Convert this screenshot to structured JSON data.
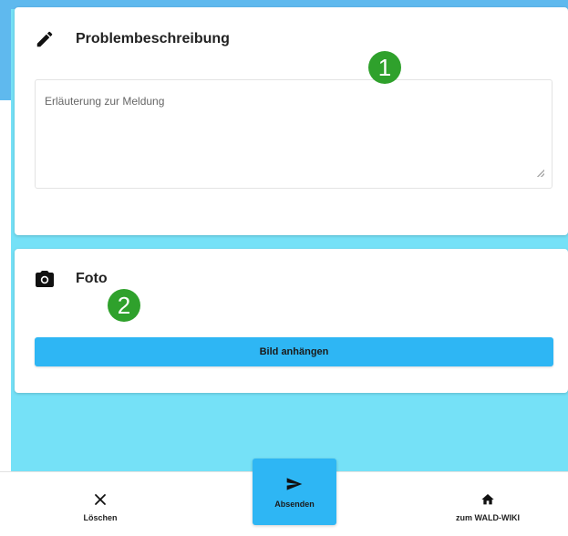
{
  "problem_card": {
    "title": "Problembeschreibung",
    "icon": "pencil-icon",
    "textarea_placeholder": "Erläuterung zur Meldung",
    "textarea_value": ""
  },
  "photo_card": {
    "title": "Foto",
    "icon": "camera-icon",
    "attach_label": "Bild anhängen"
  },
  "markers": {
    "marker_1": "1",
    "marker_2": "2"
  },
  "bottom_nav": {
    "delete_label": "Löschen",
    "send_label": "Absenden",
    "wiki_label": "zum WALD-WIKI"
  },
  "colors": {
    "page_background": "#75e1f7",
    "accent": "#2eb6f4",
    "marker": "#2fa12c"
  }
}
